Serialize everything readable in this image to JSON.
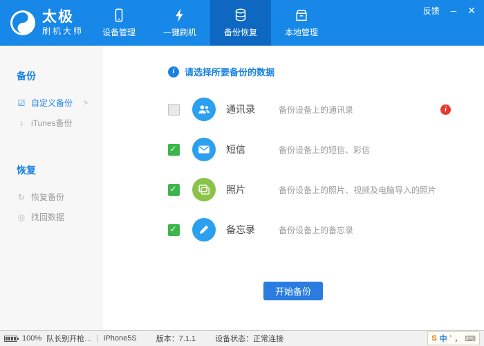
{
  "colors": {
    "header_blue": "#1787e8",
    "active_tab_blue": "#0e68c2",
    "accent_blue": "#1a82e2",
    "checkbox_green": "#3cb54a",
    "badge_red": "#e6392f",
    "icon_blue": "#2b9ff0",
    "icon_green": "#8bc349",
    "button_blue": "#2a7ce0"
  },
  "header": {
    "logo_title": "太极",
    "logo_subtitle": "刷机大师",
    "tabs": [
      {
        "label": "设备管理"
      },
      {
        "label": "一键刷机"
      },
      {
        "label": "备份恢复"
      },
      {
        "label": "本地管理"
      }
    ],
    "feedback_label": "反馈",
    "minimize_label": "─",
    "close_label": "✕"
  },
  "sidebar": {
    "sections": [
      {
        "title": "备份",
        "items": [
          {
            "label": "自定义备份",
            "chevron": ">"
          },
          {
            "label": "iTunes备份"
          }
        ]
      },
      {
        "title": "恢复",
        "items": [
          {
            "label": "恢复备份"
          },
          {
            "label": "找回数据"
          }
        ]
      }
    ]
  },
  "main": {
    "prompt": "请选择所要备份的数据",
    "info_glyph": "i",
    "items": [
      {
        "name": "通讯录",
        "desc": "备份设备上的通讯录",
        "checked": false,
        "badge": "i"
      },
      {
        "name": "短信",
        "desc": "备份设备上的短信、彩信",
        "checked": true
      },
      {
        "name": "照片",
        "desc": "备份设备上的照片、视频及电脑导入的照片",
        "checked": true
      },
      {
        "name": "备忘录",
        "desc": "备份设备上的备忘录",
        "checked": true
      }
    ],
    "start_button": "开始备份"
  },
  "statusbar": {
    "battery": "100%",
    "device_name": "队长别开枪…",
    "separator": "|",
    "device_model": "iPhone5S",
    "version": "版本：7.1.1",
    "status": "设备状态：正常连接",
    "ime": [
      "S",
      "中",
      "’",
      "，",
      "⌨"
    ]
  }
}
